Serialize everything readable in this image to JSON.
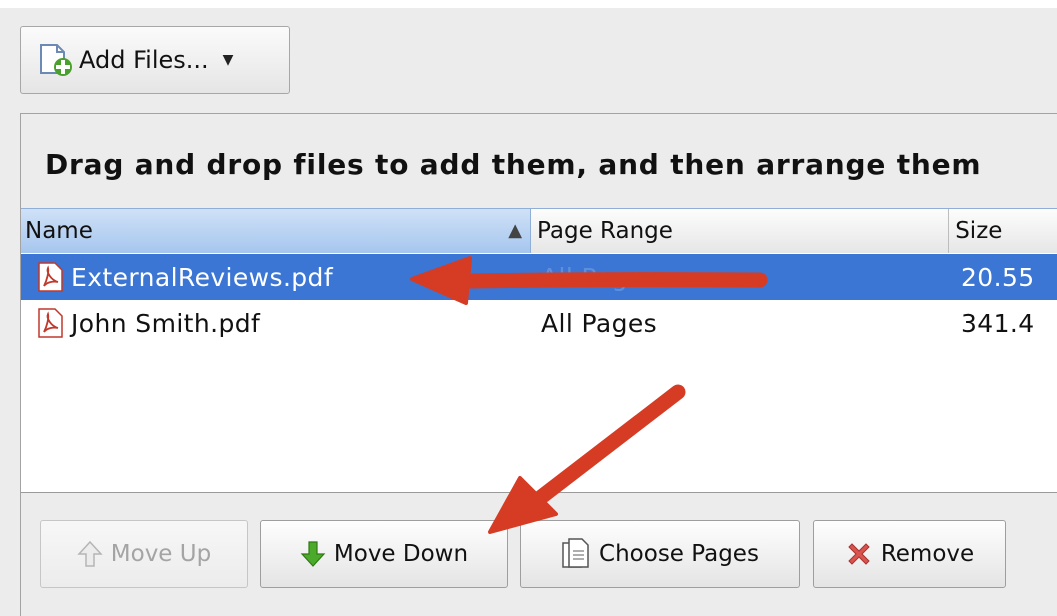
{
  "toolbar": {
    "add_files_label": "Add Files...",
    "add_files_icon": "add-file-icon",
    "dropdown_icon": "caret-down-icon"
  },
  "instructions": "Drag and drop files to add them, and then arrange them",
  "table": {
    "columns": [
      "Name",
      "Page Range",
      "Size"
    ],
    "sort": {
      "column": "Name",
      "direction": "ascending"
    },
    "rows": [
      {
        "name": "ExternalReviews.pdf",
        "range": "All Pages",
        "size": "20.55",
        "selected": true,
        "icon": "pdf-file-icon"
      },
      {
        "name": "John Smith.pdf",
        "range": "All Pages",
        "size": "341.4",
        "selected": false,
        "icon": "pdf-file-icon"
      }
    ]
  },
  "buttons": {
    "move_up": {
      "label": "Move Up",
      "icon": "arrow-up-icon",
      "enabled": false
    },
    "move_down": {
      "label": "Move Down",
      "icon": "arrow-down-icon",
      "enabled": true
    },
    "choose_pages": {
      "label": "Choose Pages",
      "icon": "document-pages-icon",
      "enabled": true
    },
    "remove": {
      "label": "Remove",
      "icon": "remove-x-icon",
      "enabled": true
    }
  },
  "colors": {
    "selection": "#3b76d4",
    "annotation_arrow": "#d63b24",
    "header_sorted": "#a6c6ee"
  }
}
